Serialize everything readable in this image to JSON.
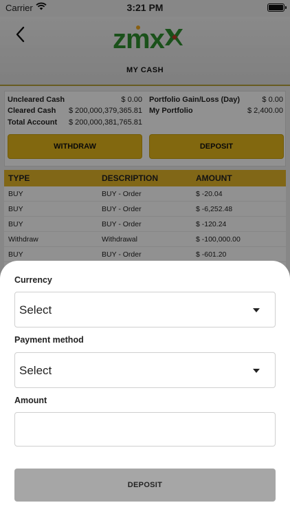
{
  "status_bar": {
    "carrier": "Carrier",
    "time": "3:21 PM"
  },
  "header": {
    "logo_text": "zmx",
    "title": "MY CASH",
    "logo_colors": [
      "#2f8f2f",
      "#f0a81e",
      "#c0392b",
      "#2b5ea8"
    ]
  },
  "summary": {
    "left": [
      {
        "label": "Uncleared Cash",
        "value": "$ 0.00"
      },
      {
        "label": "Cleared Cash",
        "value": "$ 200,000,379,365.81"
      },
      {
        "label": "Total Account",
        "value": "$ 200,000,381,765.81"
      }
    ],
    "right": [
      {
        "label": "Portfolio Gain/Loss (Day)",
        "value": "$ 0.00"
      },
      {
        "label": "My Portfolio",
        "value": "$ 2,400.00"
      }
    ],
    "withdraw_label": "WITHDRAW",
    "deposit_label": "DEPOSIT"
  },
  "table": {
    "headers": [
      "TYPE",
      "DESCRIPTION",
      "AMOUNT"
    ],
    "rows": [
      [
        "BUY",
        "BUY - Order",
        "$ -20.04"
      ],
      [
        "BUY",
        "BUY - Order",
        "$ -6,252.48"
      ],
      [
        "BUY",
        "BUY - Order",
        "$ -120.24"
      ],
      [
        "Withdraw",
        "Withdrawal",
        "$ -100,000.00"
      ],
      [
        "BUY",
        "BUY - Order",
        "$ -601.20"
      ]
    ]
  },
  "sheet": {
    "currency_label": "Currency",
    "currency_value": "Select",
    "payment_label": "Payment method",
    "payment_value": "Select",
    "amount_label": "Amount",
    "amount_value": "",
    "submit_label": "DEPOSIT"
  },
  "colors": {
    "accent": "#e5b71b",
    "button_disabled": "#a6a6a6",
    "brand_green": "#2f8f2f"
  }
}
